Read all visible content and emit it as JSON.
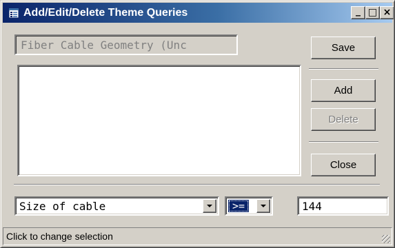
{
  "window": {
    "title": "Add/Edit/Delete Theme Queries",
    "controls": {
      "minimize_glyph": "_",
      "maximize_glyph": "□",
      "close_glyph": "×"
    }
  },
  "query_name": {
    "value": "Fiber Cable Geometry (Unc"
  },
  "query_list": {
    "items": []
  },
  "buttons": {
    "save": "Save",
    "add": "Add",
    "delete": "Delete",
    "close": "Close"
  },
  "condition": {
    "field": "Size of cable",
    "operator": ">=",
    "value": "144"
  },
  "statusbar": {
    "text": "Click to change selection"
  },
  "colors": {
    "title_active": "#0a246a",
    "face": "#d4d0c8",
    "selection": "#0a246a"
  },
  "icons": {
    "app": "app-list-icon"
  }
}
